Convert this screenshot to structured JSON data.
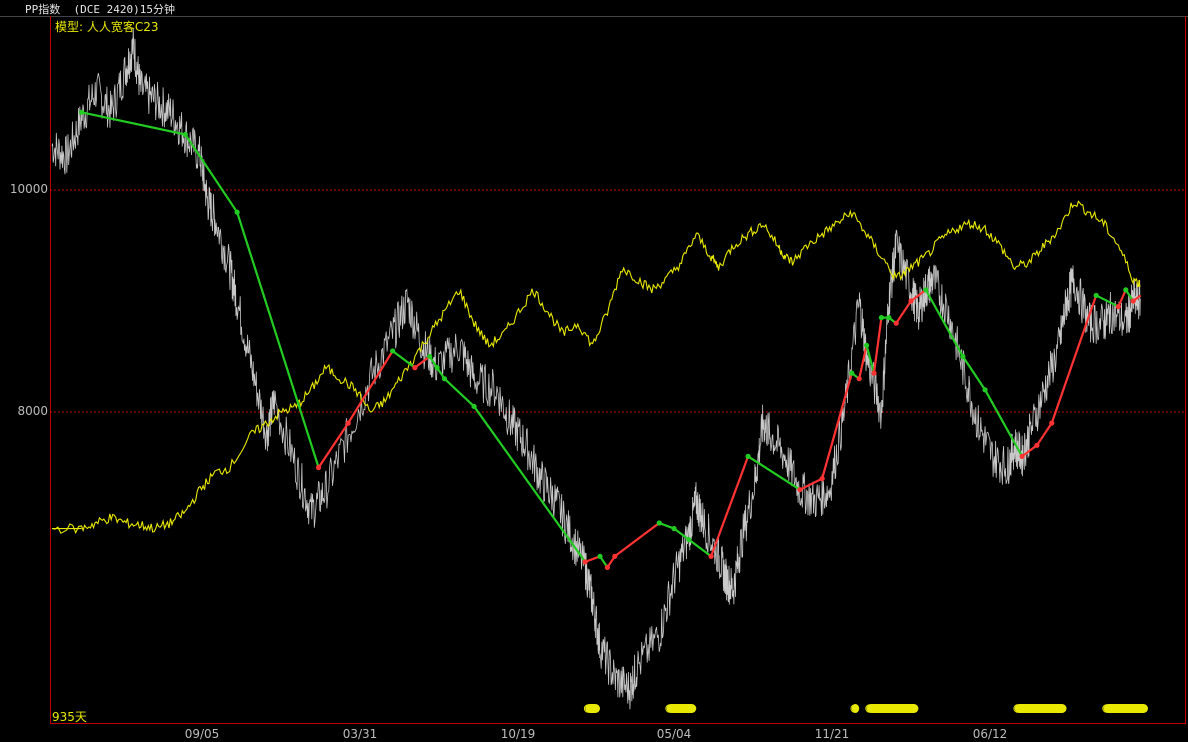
{
  "window": {
    "title": "PP指数  (DCE 2420)15分钟"
  },
  "labels": {
    "model": "模型: 人人宽客C23",
    "days": "935天"
  },
  "colors": {
    "price": "#c8c8c8",
    "indicator": "#e8e800",
    "buy_leg": "#ff3333",
    "sell_leg": "#22cc22",
    "grid": "#c00000",
    "signal": "#e8e800"
  },
  "chart_data": {
    "type": "line",
    "title": "",
    "xlabel": "",
    "ylabel": "",
    "ylim": [
      6500,
      10700
    ],
    "x_ticks": [
      "09/05",
      "03/31",
      "10/19",
      "05/04",
      "11/21",
      "06/12"
    ],
    "y_ticks": [
      8000,
      10000
    ],
    "grid": true,
    "series": [
      {
        "role": "price",
        "points": [
          [
            0,
            10400
          ],
          [
            2,
            10300
          ],
          [
            4,
            10650
          ],
          [
            6,
            10900
          ],
          [
            8,
            10700
          ],
          [
            10,
            11100
          ],
          [
            11,
            11300
          ],
          [
            12,
            10900
          ],
          [
            14,
            10800
          ],
          [
            16,
            10700
          ],
          [
            18,
            10500
          ],
          [
            20,
            10300
          ],
          [
            21,
            9900
          ],
          [
            22,
            9750
          ],
          [
            24,
            9300
          ],
          [
            25,
            9000
          ],
          [
            27,
            8400
          ],
          [
            29,
            7800
          ],
          [
            30,
            8100
          ],
          [
            33,
            7500
          ],
          [
            35,
            7100
          ],
          [
            37,
            7300
          ],
          [
            40,
            7800
          ],
          [
            43,
            8300
          ],
          [
            46,
            8700
          ],
          [
            48,
            9000
          ],
          [
            50,
            8600
          ],
          [
            52,
            8400
          ],
          [
            55,
            8600
          ],
          [
            57,
            8300
          ],
          [
            60,
            8200
          ],
          [
            62,
            7900
          ],
          [
            64,
            7700
          ],
          [
            66,
            7400
          ],
          [
            68,
            7200
          ],
          [
            70,
            6900
          ],
          [
            72,
            6600
          ],
          [
            73,
            6300
          ],
          [
            74,
            5900
          ],
          [
            76,
            5600
          ],
          [
            78,
            5500
          ],
          [
            79,
            5700
          ],
          [
            82,
            6000
          ],
          [
            84,
            6500
          ],
          [
            86,
            6900
          ],
          [
            87,
            7200
          ],
          [
            88,
            7000
          ],
          [
            90,
            6700
          ],
          [
            91,
            6500
          ],
          [
            92,
            6400
          ],
          [
            93,
            6800
          ],
          [
            95,
            7400
          ],
          [
            96,
            7900
          ],
          [
            97,
            7800
          ],
          [
            99,
            7600
          ],
          [
            101,
            7300
          ],
          [
            103,
            7200
          ],
          [
            105,
            7300
          ],
          [
            107,
            8000
          ],
          [
            109,
            9000
          ],
          [
            110,
            8500
          ],
          [
            112,
            8000
          ],
          [
            113,
            9000
          ],
          [
            114,
            9500
          ],
          [
            116,
            9100
          ],
          [
            117,
            8900
          ],
          [
            118,
            9100
          ],
          [
            119,
            9200
          ],
          [
            121,
            8900
          ],
          [
            123,
            8400
          ],
          [
            125,
            7900
          ],
          [
            127,
            7600
          ],
          [
            129,
            7500
          ],
          [
            130,
            7700
          ],
          [
            131,
            7600
          ],
          [
            132,
            7800
          ],
          [
            134,
            8200
          ],
          [
            136,
            8600
          ],
          [
            137,
            9000
          ],
          [
            138,
            9200
          ],
          [
            140,
            8800
          ],
          [
            142,
            8800
          ],
          [
            143,
            8900
          ],
          [
            145,
            8800
          ],
          [
            146,
            9000
          ],
          [
            147,
            9000
          ]
        ]
      },
      {
        "role": "indicator",
        "points": [
          [
            0,
            6950
          ],
          [
            4,
            6950
          ],
          [
            6,
            7000
          ],
          [
            8,
            7050
          ],
          [
            10,
            7000
          ],
          [
            12,
            6980
          ],
          [
            14,
            6950
          ],
          [
            16,
            7000
          ],
          [
            18,
            7100
          ],
          [
            20,
            7300
          ],
          [
            22,
            7450
          ],
          [
            24,
            7500
          ],
          [
            27,
            7800
          ],
          [
            29,
            7900
          ],
          [
            31,
            8000
          ],
          [
            33,
            8050
          ],
          [
            35,
            8200
          ],
          [
            37,
            8400
          ],
          [
            39,
            8300
          ],
          [
            41,
            8200
          ],
          [
            43,
            8000
          ],
          [
            45,
            8100
          ],
          [
            47,
            8300
          ],
          [
            49,
            8500
          ],
          [
            51,
            8700
          ],
          [
            53,
            8900
          ],
          [
            55,
            9100
          ],
          [
            57,
            8800
          ],
          [
            59,
            8600
          ],
          [
            61,
            8700
          ],
          [
            63,
            8900
          ],
          [
            65,
            9100
          ],
          [
            67,
            8900
          ],
          [
            69,
            8700
          ],
          [
            71,
            8800
          ],
          [
            73,
            8600
          ],
          [
            75,
            8900
          ],
          [
            77,
            9300
          ],
          [
            79,
            9200
          ],
          [
            81,
            9100
          ],
          [
            83,
            9200
          ],
          [
            85,
            9350
          ],
          [
            87,
            9600
          ],
          [
            89,
            9400
          ],
          [
            90,
            9300
          ],
          [
            92,
            9500
          ],
          [
            94,
            9600
          ],
          [
            96,
            9700
          ],
          [
            98,
            9500
          ],
          [
            99,
            9400
          ],
          [
            100,
            9350
          ],
          [
            102,
            9500
          ],
          [
            104,
            9600
          ],
          [
            106,
            9700
          ],
          [
            108,
            9800
          ],
          [
            110,
            9600
          ],
          [
            112,
            9400
          ],
          [
            114,
            9200
          ],
          [
            116,
            9300
          ],
          [
            118,
            9400
          ],
          [
            120,
            9550
          ],
          [
            122,
            9650
          ],
          [
            124,
            9700
          ],
          [
            126,
            9650
          ],
          [
            128,
            9500
          ],
          [
            130,
            9300
          ],
          [
            132,
            9350
          ],
          [
            134,
            9500
          ],
          [
            136,
            9650
          ],
          [
            138,
            9900
          ],
          [
            140,
            9800
          ],
          [
            142,
            9700
          ],
          [
            144,
            9500
          ],
          [
            146,
            9200
          ],
          [
            147,
            9150
          ]
        ]
      },
      {
        "role": "signal_legs",
        "points": [
          [
            4,
            10700
          ],
          [
            18,
            10500
          ],
          [
            25,
            9800
          ],
          [
            36,
            7500
          ],
          [
            40,
            7900
          ],
          [
            46,
            8550
          ],
          [
            49,
            8400
          ],
          [
            51,
            8500
          ],
          [
            52,
            8400
          ],
          [
            53,
            8300
          ],
          [
            57,
            8050
          ],
          [
            72,
            6650
          ],
          [
            74,
            6700
          ],
          [
            75,
            6600
          ],
          [
            76,
            6700
          ],
          [
            82,
            7000
          ],
          [
            84,
            6950
          ],
          [
            86,
            6850
          ],
          [
            89,
            6700
          ],
          [
            94,
            7600
          ],
          [
            101,
            7300
          ],
          [
            104,
            7400
          ],
          [
            108,
            8350
          ],
          [
            109,
            8300
          ],
          [
            110,
            8600
          ],
          [
            111,
            8350
          ],
          [
            112,
            8850
          ],
          [
            113,
            8850
          ],
          [
            114,
            8800
          ],
          [
            116,
            9000
          ],
          [
            118,
            9100
          ],
          [
            123,
            8500
          ],
          [
            126,
            8200
          ],
          [
            131,
            7600
          ],
          [
            133,
            7700
          ],
          [
            135,
            7900
          ],
          [
            141,
            9050
          ],
          [
            144,
            8950
          ],
          [
            145,
            9100
          ],
          [
            146,
            9000
          ],
          [
            147,
            9050
          ]
        ]
      }
    ],
    "signal_bands": [
      [
        72,
        74
      ],
      [
        83,
        87
      ],
      [
        108,
        109
      ],
      [
        110,
        117
      ],
      [
        130,
        137
      ],
      [
        142,
        148
      ]
    ]
  }
}
